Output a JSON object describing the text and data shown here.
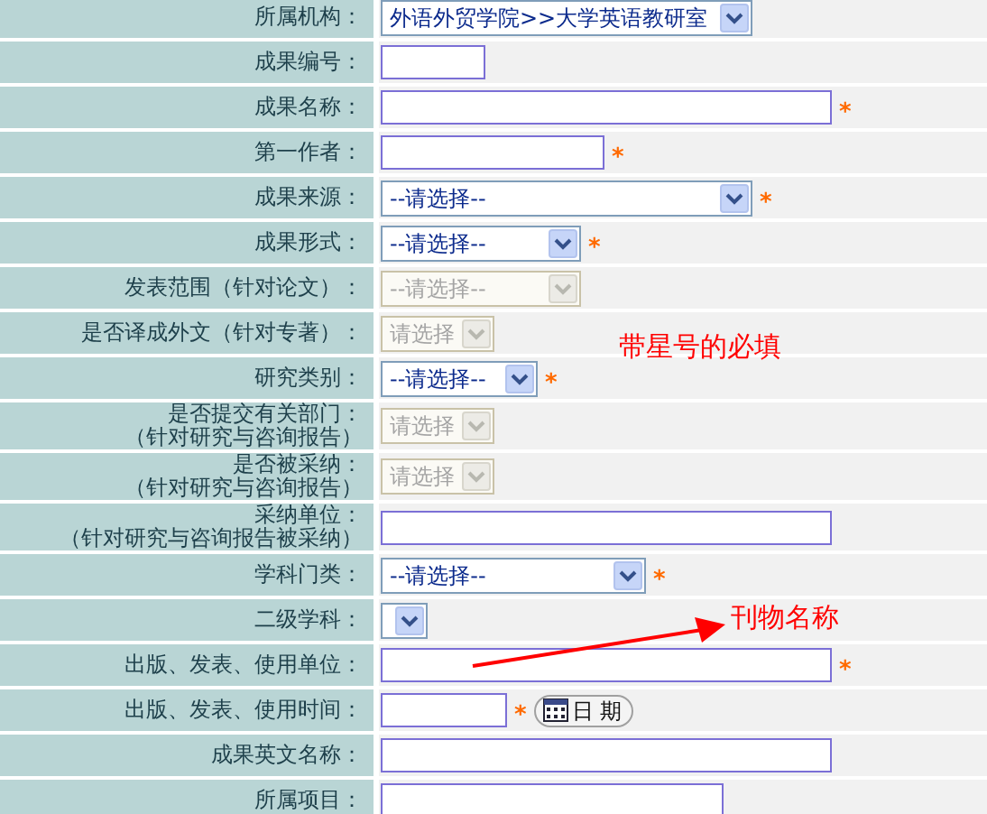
{
  "form_rows": [
    {
      "label": "所属机构：",
      "kind": "select",
      "value": "外语外贸学院>>大学英语教研室",
      "disabled": false
    },
    {
      "label": "成果编号：",
      "kind": "input"
    },
    {
      "label": "成果名称：",
      "kind": "input",
      "star": "*"
    },
    {
      "label": "第一作者：",
      "kind": "input",
      "star": "*"
    },
    {
      "label": "成果来源：",
      "kind": "select",
      "value": "--请选择--",
      "disabled": false,
      "star": "*"
    },
    {
      "label": "成果形式：",
      "kind": "select",
      "value": "--请选择--",
      "disabled": false,
      "star": "*"
    },
    {
      "label": "发表范围（针对论文）：",
      "kind": "select",
      "value": "--请选择--",
      "disabled": true
    },
    {
      "label": "是否译成外文（针对专著）：",
      "kind": "select",
      "value": "请选择",
      "disabled": true
    },
    {
      "label": "研究类别：",
      "kind": "select",
      "value": "--请选择--",
      "disabled": false,
      "star": "*"
    },
    {
      "label": "是否提交有关部门：",
      "label_2": "（针对研究与咨询报告）",
      "kind": "select",
      "value": "请选择",
      "disabled": true
    },
    {
      "label": "是否被采纳：",
      "label_2": "（针对研究与咨询报告）",
      "kind": "select",
      "value": "请选择",
      "disabled": true
    },
    {
      "label": "采纳单位：",
      "label_2": "（针对研究与咨询报告被采纳）",
      "kind": "input"
    },
    {
      "label": "学科门类：",
      "kind": "select",
      "value": "--请选择--",
      "disabled": false,
      "star": "*"
    },
    {
      "label": "二级学科：",
      "kind": "select",
      "disabled": false
    },
    {
      "label": "出版、发表、使用单位：",
      "kind": "input",
      "star": "*"
    },
    {
      "label": "出版、发表、使用时间：",
      "kind": "date",
      "star": "*",
      "button": "日 期"
    },
    {
      "label": "成果英文名称：",
      "kind": "input"
    },
    {
      "label": "所属项目：",
      "kind": "input"
    }
  ],
  "annotations": [
    {
      "text": "带星号的必填",
      "kind": "note"
    },
    {
      "text": "刊物名称",
      "kind": "arrow-note"
    }
  ]
}
